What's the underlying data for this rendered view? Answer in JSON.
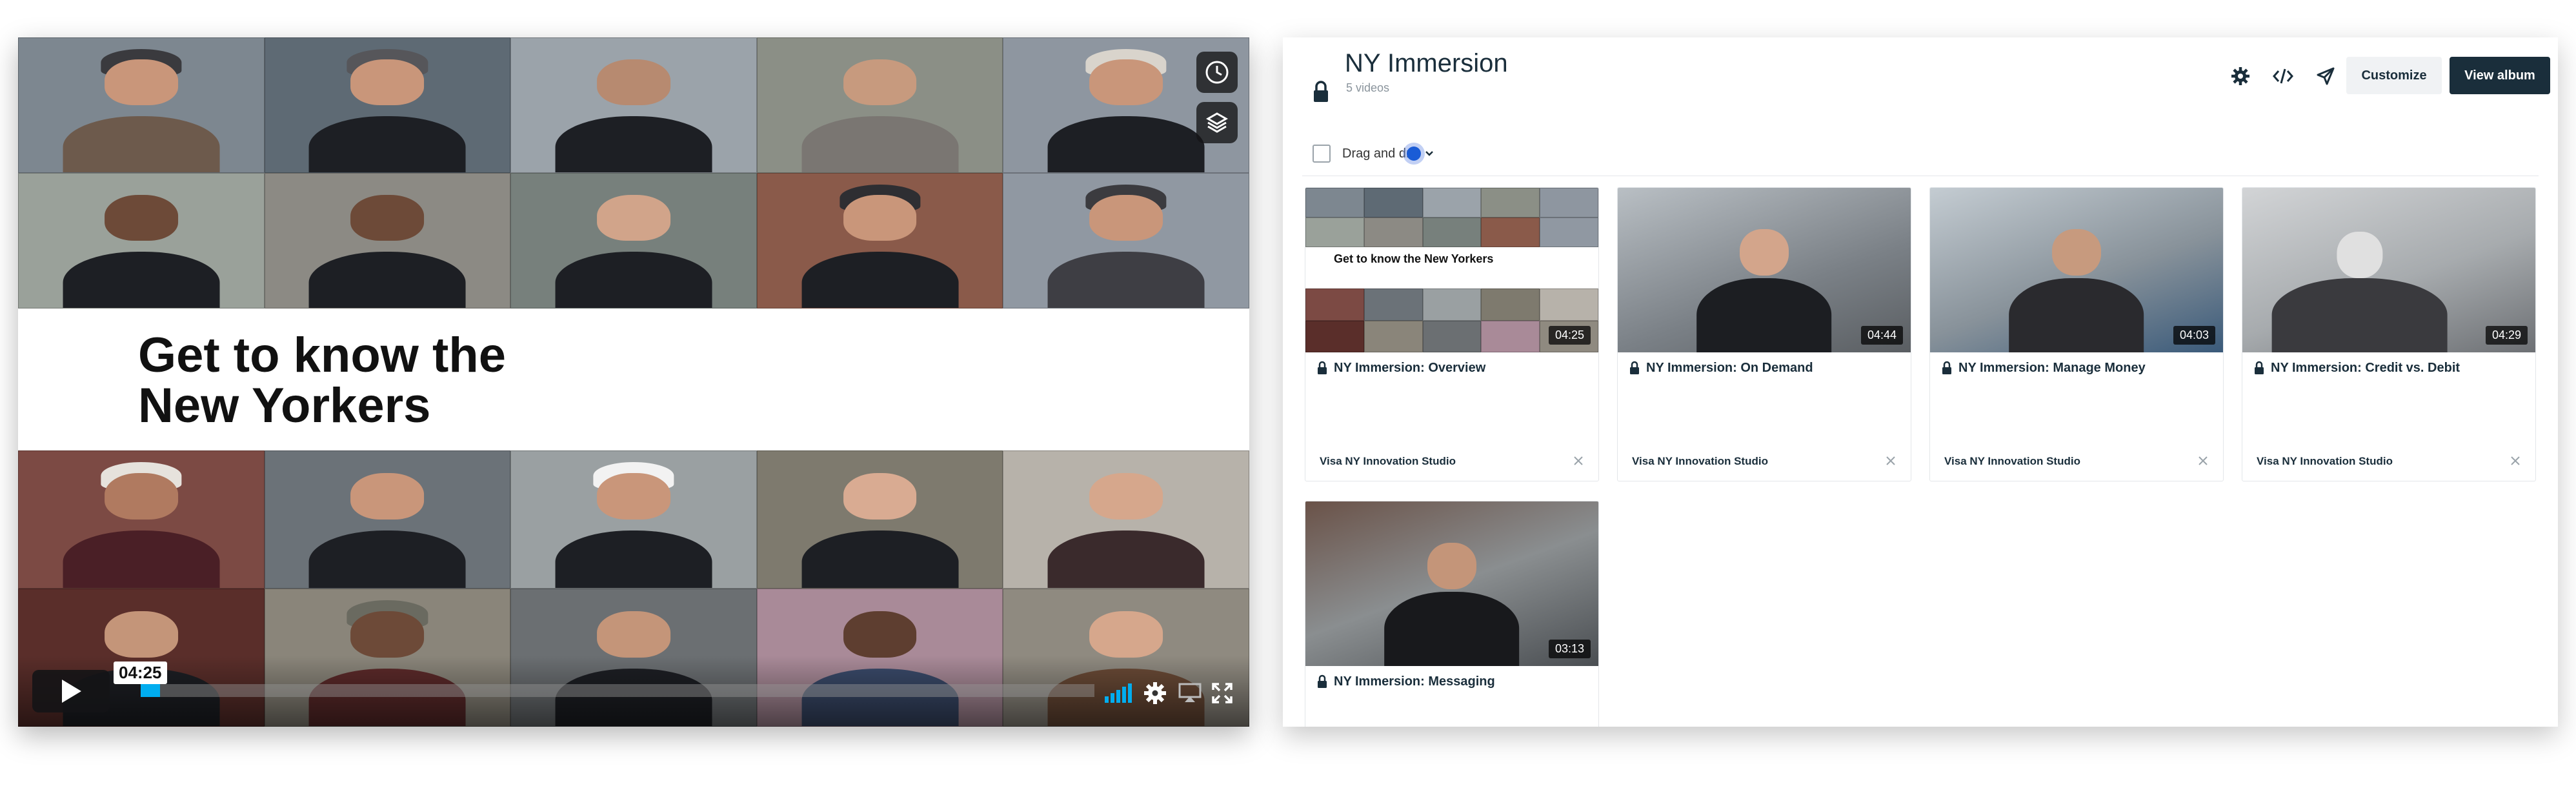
{
  "player": {
    "title_line1": "Get to know the",
    "title_line2": "New Yorkers",
    "current_time": "04:25",
    "progress": 0.02,
    "icons": {
      "watch_later": "clock-icon",
      "collections": "layers-icon",
      "play": "play-icon",
      "quality": "signal-bars-icon",
      "settings": "gear-icon",
      "airplay": "airplay-icon",
      "fullscreen": "fullscreen-icon"
    },
    "accent_color": "#00adef"
  },
  "album": {
    "title": "NY Immersion",
    "video_count": "5 videos",
    "toolbar": {
      "settings_icon": "gear-icon",
      "embed_icon": "code-icon",
      "share_icon": "send-icon",
      "customize_label": "Customize",
      "view_album_label": "View album"
    },
    "drag_label": "Drag and dr",
    "videos": [
      {
        "title": "NY Immersion: Overview",
        "owner": "Visa NY Innovation Studio",
        "duration": "04:25",
        "thumb_title": "Get to know the New Yorkers"
      },
      {
        "title": "NY Immersion: On Demand",
        "owner": "Visa NY Innovation Studio",
        "duration": "04:44"
      },
      {
        "title": "NY Immersion: Manage Money",
        "owner": "Visa NY Innovation Studio",
        "duration": "04:03"
      },
      {
        "title": "NY Immersion: Credit vs. Debit",
        "owner": "Visa NY Innovation Studio",
        "duration": "04:29"
      },
      {
        "title": "NY Immersion: Messaging",
        "owner": "",
        "duration": "03:13"
      }
    ],
    "colors": {
      "navy": "#1a2e3b",
      "toggle_blue": "#1a5cd6"
    }
  }
}
